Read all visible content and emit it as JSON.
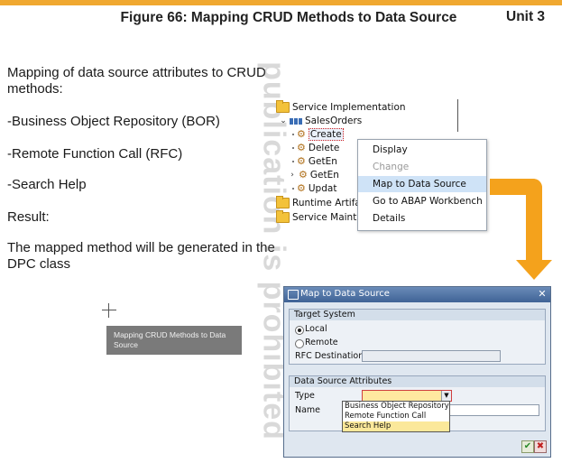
{
  "header": {
    "figure_title": "Figure 66: Mapping CRUD Methods to Data Source",
    "unit": "Unit 3"
  },
  "content": {
    "intro": "Mapping of data source attributes to CRUD methods:",
    "bor": "-Business Object Repository (BOR)",
    "rfc": "-Remote Function Call (RFC)",
    "search_help": "-Search Help",
    "result_label": "Result:",
    "result_text": "The mapped method will be generated in the DPC class"
  },
  "watermark": "publication is prohibited",
  "tree": {
    "service_implementation": "Service Implementation",
    "sales_orders": "SalesOrders",
    "create": "Create",
    "delete": "Delete",
    "getentity": "GetEn",
    "getentityset": "GetEn",
    "update": "Updat",
    "runtime_artifacts": "Runtime Artifa",
    "service_maintenance": "Service Mainte"
  },
  "context_menu": {
    "items": [
      {
        "label": "Display",
        "state": "enabled"
      },
      {
        "label": "Change",
        "state": "disabled"
      },
      {
        "label": "Map to Data Source",
        "state": "selected"
      },
      {
        "label": "Go to ABAP Workbench",
        "state": "enabled"
      },
      {
        "label": "Details",
        "state": "enabled"
      }
    ]
  },
  "dialog": {
    "title": "Map to Data Source",
    "target_system_title": "Target System",
    "local_label": "Local",
    "remote_label": "Remote",
    "rfc_destination_label": "RFC Destination",
    "rfc_destination_value": "",
    "attributes_title": "Data Source Attributes",
    "type_label": "Type",
    "type_value": "",
    "name_label": "Name",
    "name_value": "",
    "dropdown_options": [
      "Business Object Repository",
      "Remote Function Call",
      "Search Help"
    ],
    "selected_option": "Search Help",
    "ok_symbol": "✔",
    "cancel_symbol": "✖"
  },
  "tooltip": "Mapping CRUD Methods to Data Source",
  "colors": {
    "accent_orange": "#f4a21c",
    "dialog_title": "#3f6396",
    "menu_highlight": "#cfe3f7"
  }
}
